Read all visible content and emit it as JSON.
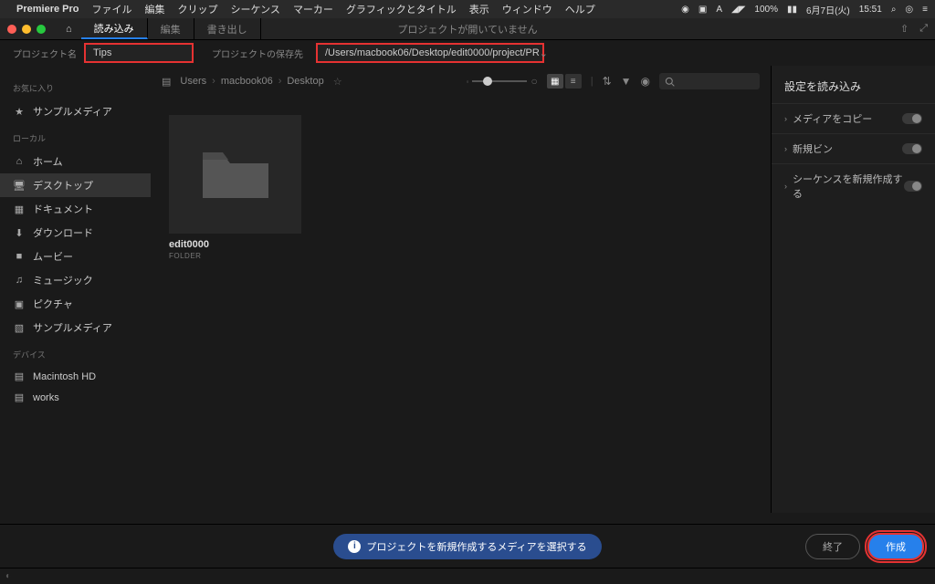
{
  "menubar": {
    "app": "Premiere Pro",
    "items": [
      "ファイル",
      "編集",
      "クリップ",
      "シーケンス",
      "マーカー",
      "グラフィックとタイトル",
      "表示",
      "ウィンドウ",
      "ヘルプ"
    ],
    "status_wifi": "100%",
    "status_date": "6月7日(火)",
    "status_time": "15:51"
  },
  "window": {
    "tabs": [
      "読み込み",
      "編集",
      "書き出し"
    ],
    "active_tab": 0,
    "message": "プロジェクトが開いていません"
  },
  "project": {
    "name_label": "プロジェクト名",
    "name_value": "Tips",
    "path_label": "プロジェクトの保存先",
    "path_value": "/Users/macbook06/Desktop/edit0000/project/PR"
  },
  "sidebar": {
    "sec_fav": "お気に入り",
    "fav": [
      {
        "icon": "★",
        "label": "サンプルメディア"
      }
    ],
    "sec_local": "ローカル",
    "local": [
      {
        "icon": "⌂",
        "label": "ホーム"
      },
      {
        "icon": "🖥",
        "label": "デスクトップ"
      },
      {
        "icon": "▦",
        "label": "ドキュメント"
      },
      {
        "icon": "⬇",
        "label": "ダウンロード"
      },
      {
        "icon": "■",
        "label": "ムービー"
      },
      {
        "icon": "♫",
        "label": "ミュージック"
      },
      {
        "icon": "▣",
        "label": "ピクチャ"
      },
      {
        "icon": "▧",
        "label": "サンプルメディア"
      }
    ],
    "sec_dev": "デバイス",
    "devices": [
      {
        "icon": "▤",
        "label": "Macintosh HD"
      },
      {
        "icon": "▤",
        "label": "works"
      }
    ]
  },
  "content": {
    "crumbs": [
      "Users",
      "macbook06",
      "Desktop"
    ],
    "folder": {
      "name": "edit0000",
      "type": "FOLDER"
    }
  },
  "rpanel": {
    "title": "設定を読み込み",
    "items": [
      "メディアをコピー",
      "新規ビン",
      "シーケンスを新規作成する"
    ]
  },
  "bottom": {
    "info": "プロジェクトを新規作成するメディアを選択する",
    "cancel": "終了",
    "create": "作成"
  }
}
